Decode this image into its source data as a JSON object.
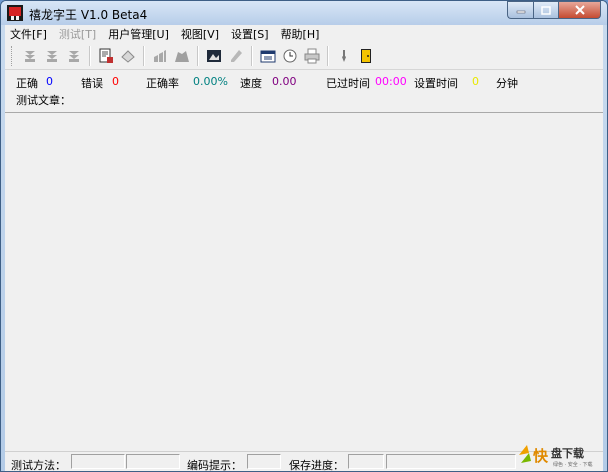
{
  "window": {
    "title": "禧龙字王 V1.0 Beta4"
  },
  "menu": {
    "items": [
      {
        "label": "文件[F]",
        "enabled": true
      },
      {
        "label": "测试[T]",
        "enabled": false
      },
      {
        "label": "用户管理[U]",
        "enabled": true
      },
      {
        "label": "视图[V]",
        "enabled": true
      },
      {
        "label": "设置[S]",
        "enabled": true
      },
      {
        "label": "帮助[H]",
        "enabled": true
      }
    ]
  },
  "stats": {
    "correct_label": "正确",
    "correct_value": "0",
    "error_label": "错误",
    "error_value": "0",
    "accuracy_label": "正确率",
    "accuracy_value": "0.00%",
    "speed_label": "速度",
    "speed_value": "0.00",
    "elapsed_label": "已过时间",
    "elapsed_value": "00:00",
    "settime_label": "设置时间",
    "settime_value": "0",
    "minutes_label": "分钟",
    "article_label": "测试文章："
  },
  "bottom": {
    "method_label": "测试方法：",
    "code_hint_label": "编码提示：",
    "save_progress_label": "保存进度："
  },
  "colors": {
    "correct": "#0000ff",
    "error": "#ff0000",
    "accuracy": "#008080",
    "speed": "#800080",
    "elapsed": "#ff00ff",
    "settime": "#e8e800"
  }
}
